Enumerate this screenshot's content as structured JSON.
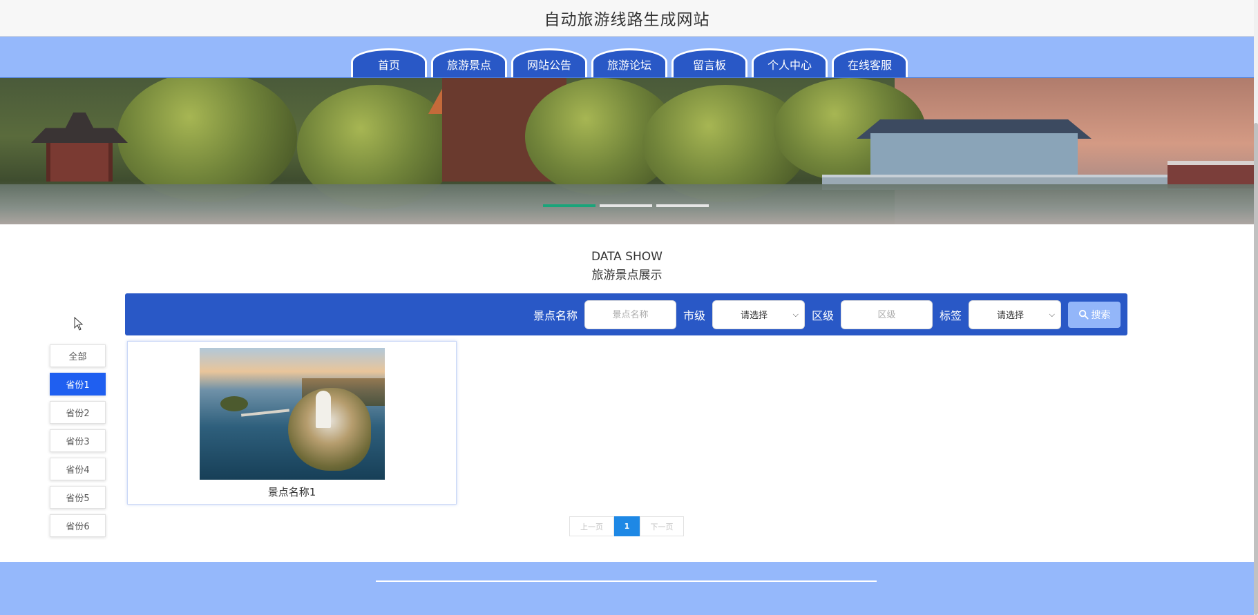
{
  "header": {
    "title": "自动旅游线路生成网站"
  },
  "nav": {
    "tabs": [
      {
        "label": "首页"
      },
      {
        "label": "旅游景点"
      },
      {
        "label": "网站公告"
      },
      {
        "label": "旅游论坛"
      },
      {
        "label": "留言板"
      },
      {
        "label": "个人中心"
      },
      {
        "label": "在线客服"
      }
    ]
  },
  "banner": {
    "slide_count": 3,
    "active_slide": 1,
    "accent_color": "#1aa57a"
  },
  "section": {
    "title_en": "DATA SHOW",
    "title_cn": "旅游景点展示"
  },
  "search": {
    "name_label": "景点名称",
    "name_placeholder": "景点名称",
    "city_label": "市级",
    "city_value": "请选择",
    "district_label": "区级",
    "district_placeholder": "区级",
    "tag_label": "标签",
    "tag_value": "请选择",
    "button_label": "搜索",
    "bar_color": "#2958c6"
  },
  "categories": {
    "items": [
      {
        "label": "全部"
      },
      {
        "label": "省份1"
      },
      {
        "label": "省份2"
      },
      {
        "label": "省份3"
      },
      {
        "label": "省份4"
      },
      {
        "label": "省份5"
      },
      {
        "label": "省份6"
      }
    ],
    "active_index": 1,
    "active_color": "#1f5ff0"
  },
  "results": {
    "items": [
      {
        "name": "景点名称1"
      }
    ]
  },
  "pagination": {
    "prev_label": "上一页",
    "current_page": "1",
    "next_label": "下一页"
  },
  "colors": {
    "nav_bg": "#95b8fb",
    "tab_bg": "#2958c6",
    "footer_bg": "#95b8fb"
  }
}
